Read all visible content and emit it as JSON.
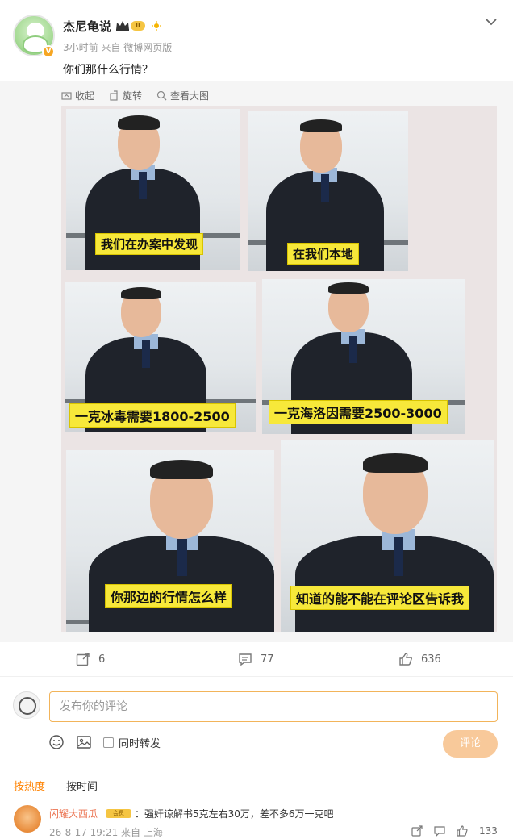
{
  "post": {
    "username": "杰尼龟说",
    "level_badge": "II",
    "meta": "3小时前  来自 微博网页版",
    "text": "你们那什么行情？",
    "verified": "V"
  },
  "media_toolbar": {
    "collapse": "收起",
    "rotate": "旋转",
    "view_large": "查看大图"
  },
  "captions": [
    "我们在办案中发现",
    "在我们本地",
    "一克冰毒需要1800-2500",
    "一克海洛因需要2500-3000",
    "你那边的行情怎么样",
    "知道的能不能在评论区告诉我"
  ],
  "stats": {
    "reposts": "6",
    "comments": "77",
    "likes": "636"
  },
  "composer": {
    "placeholder": "发布你的评论",
    "repost_label": "同时转发",
    "submit": "评论"
  },
  "sort": {
    "hot": "按热度",
    "time": "按时间"
  },
  "comment": {
    "name": "闪耀大西瓜",
    "badge": "会员",
    "text": "：强奸谅解书5克左右30万，差不多6万一克吧",
    "meta": "26-8-17 19:21 来自 上海",
    "likes": "133"
  },
  "colors": {
    "accent": "#ff8200",
    "caption_bg": "#f7e83a",
    "input_border": "#f2b45a",
    "submit_bg": "#f8c99a"
  }
}
